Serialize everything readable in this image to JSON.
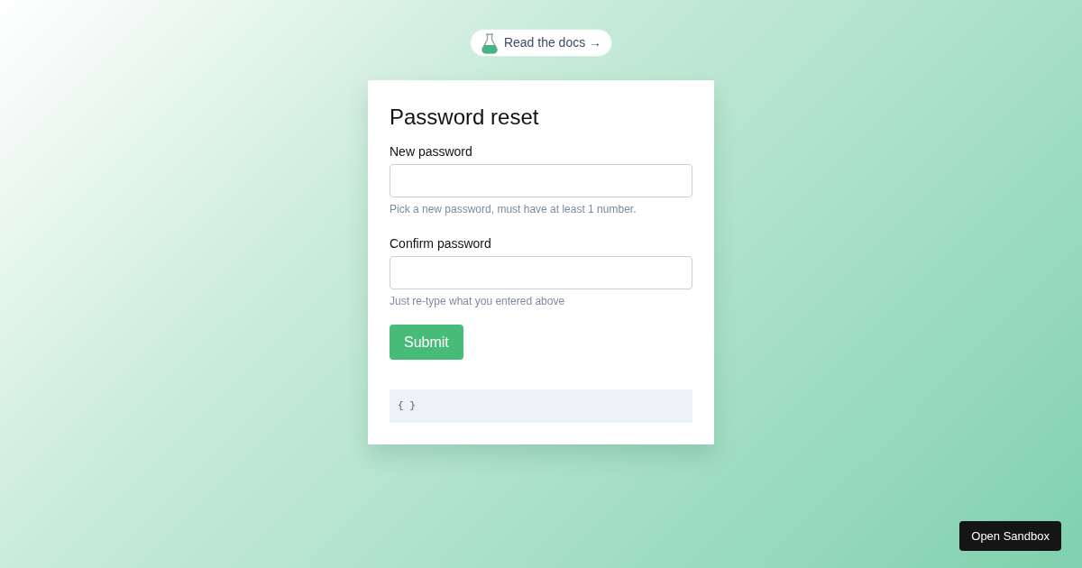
{
  "docs_link": {
    "label": "Read the docs →"
  },
  "form": {
    "title": "Password reset",
    "fields": [
      {
        "label": "New password",
        "help": "Pick a new password, must have at least 1 number."
      },
      {
        "label": "Confirm password",
        "help": "Just re-type what you entered above"
      }
    ],
    "submit": "Submit",
    "output": "{ }"
  },
  "sandbox_button": "Open Sandbox"
}
